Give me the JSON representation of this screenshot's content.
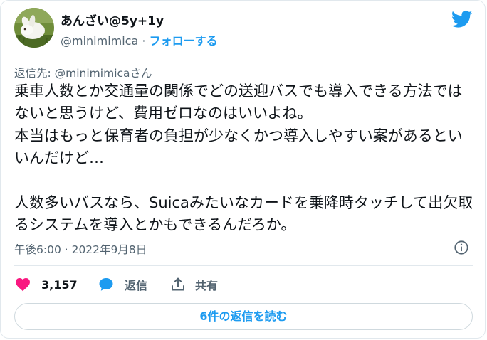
{
  "user": {
    "display_name": "あんざい@5y+1y",
    "handle": "@minimimica",
    "separator": "·",
    "follow_label": "フォローする"
  },
  "tweet": {
    "reply_to": "返信先: @minimimicaさん",
    "text": "乗車人数とか交通量の関係でどの送迎バスでも導入できる方法ではないと思うけど、費用ゼロなのはいいよね。\n本当はもっと保育者の負担が少なくかつ導入しやすい案があるといいんだけど…\n\n人数多いバスなら、Suicaみたいなカードを乗降時タッチして出欠取るシステムを導入とかもできるんだろか。",
    "timestamp": "午後6:00 · 2022年9月8日"
  },
  "actions": {
    "like_count": "3,157",
    "reply_label": "返信",
    "share_label": "共有"
  },
  "read_replies_label": "6件の返信を読む",
  "colors": {
    "accent": "#1d9bf0",
    "like": "#f91880",
    "text": "#0f1419",
    "secondary": "#536471"
  },
  "icons": [
    "twitter-bird-icon",
    "info-icon",
    "heart-icon",
    "speech-bubble-icon",
    "share-icon"
  ]
}
